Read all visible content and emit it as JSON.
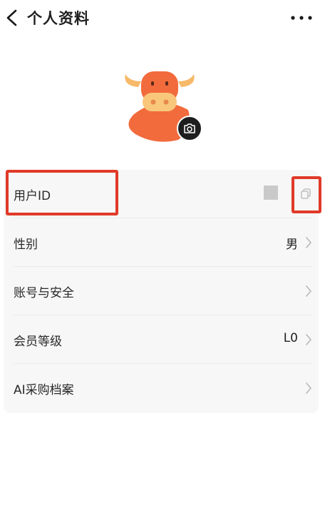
{
  "header": {
    "title": "个人资料",
    "back_icon": "chevron-left-icon",
    "more_icon": "more-dots-icon"
  },
  "avatar": {
    "icon": "bull-mascot-avatar",
    "camera_icon": "camera-icon"
  },
  "profile_rows": [
    {
      "label": "用户ID",
      "value": "",
      "action_icon": "copy-icon"
    },
    {
      "label": "性别",
      "value": "男"
    },
    {
      "label": "账号与安全",
      "value": ""
    },
    {
      "label": "会员等级",
      "value": "L0"
    },
    {
      "label": "AI采购档案",
      "value": ""
    }
  ],
  "colors": {
    "card_background": "#f7f7f7",
    "highlight": "#e03a28",
    "mascot_orange": "#f26b3d",
    "mascot_light": "#f9c77a"
  }
}
